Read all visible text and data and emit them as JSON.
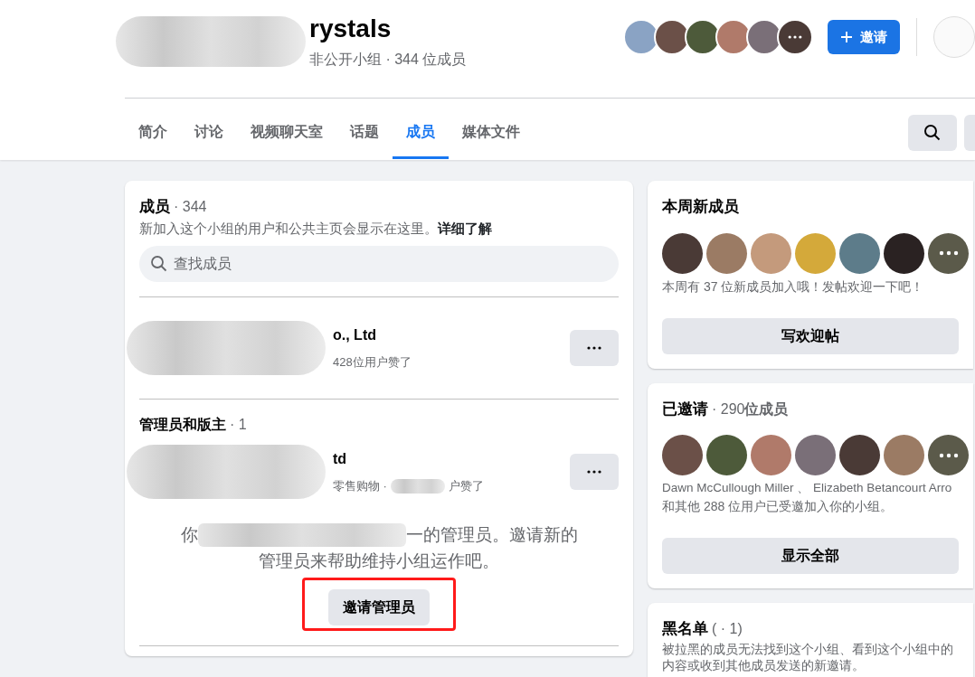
{
  "header": {
    "title": "rystals",
    "subtitle": "非公开小组 · 344 位成员",
    "invite_button": "邀请"
  },
  "tabs": [
    {
      "label": "简介",
      "selected": false
    },
    {
      "label": "讨论",
      "selected": false
    },
    {
      "label": "视频聊天室",
      "selected": false
    },
    {
      "label": "话题",
      "selected": false
    },
    {
      "label": "成员",
      "selected": true
    },
    {
      "label": "媒体文件",
      "selected": false
    }
  ],
  "members_card": {
    "title": "成员",
    "count": "· 344",
    "description": "新加入这个小组的用户和公共主页会显示在这里。",
    "learn_more": "详细了解",
    "search": {
      "placeholder": "查找成员"
    },
    "members": [
      {
        "name": "o., Ltd",
        "meta": "428位用户赞了"
      }
    ],
    "admins_title": "管理员和版主",
    "admins_count": "· 1",
    "admins": [
      {
        "name": "td",
        "meta_before": "零售购物 ·",
        "meta_after": "户赞了"
      }
    ],
    "note_before": "你",
    "note_after": "一的管理员。邀请新的",
    "note_line2": "管理员来帮助维持小组运作吧。",
    "admin_button": {
      "label": "邀请管理员",
      "highlighted": true
    }
  },
  "new_members": {
    "title": "本周新成员",
    "text": "本周有 37 位新成员加入哦！发帖欢迎一下吧！",
    "button": "写欢迎帖"
  },
  "invited": {
    "title": "已邀请",
    "count": "· 290**位成员**",
    "names": "Dawn McCullough Miller 、 Elizabeth Betancourt Arro",
    "text": "和其他 288 位用户已受邀加入你的小组。",
    "button": "显示全部"
  },
  "blocked": {
    "title": "黑名单",
    "count": "( · 1)",
    "line1": "被拉黑的成员无法找到这个小组、看到这个小组中的",
    "line2": "内容或收到其他成员发送的新邀请。"
  }
}
